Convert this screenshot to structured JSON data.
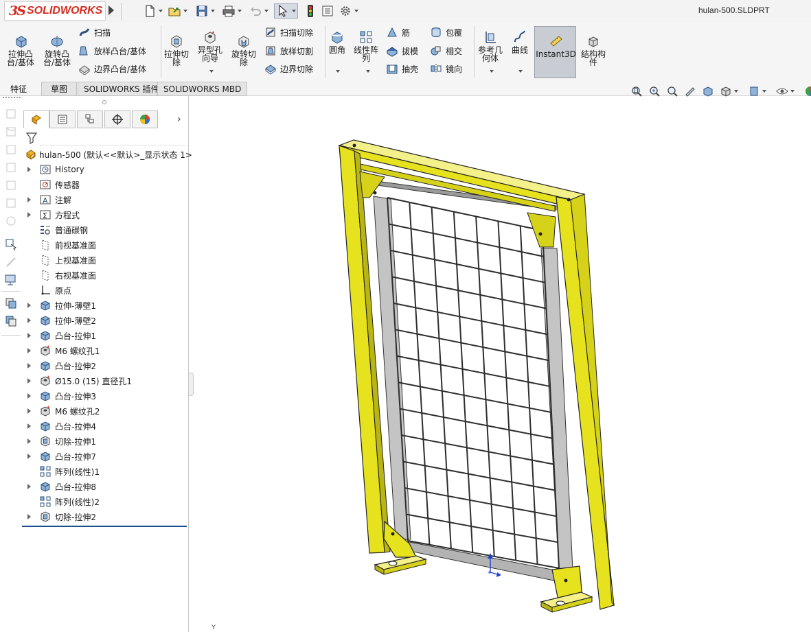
{
  "app": {
    "logo_ds": "3S",
    "logo_text": "SOLIDWORKS",
    "document_title": "hulan-500.SLDPRT"
  },
  "colors": {
    "brand_red": "#d52b1e",
    "frame_yellow": "#e6e21e",
    "panel_grey": "#bdbdbd",
    "active_tool_bg": "#c9cdd3"
  },
  "quick_access": [
    {
      "icon": "new-document-icon"
    },
    {
      "icon": "open-folder-icon"
    },
    {
      "icon": "save-icon"
    },
    {
      "icon": "print-icon"
    },
    {
      "icon": "undo-icon"
    },
    {
      "icon": "select-arrow-icon"
    },
    {
      "icon": "rebuild-traffic-light-icon"
    },
    {
      "icon": "file-properties-icon"
    },
    {
      "icon": "options-gear-icon"
    }
  ],
  "ribbon": {
    "extrude_boss_l1": "拉伸凸",
    "extrude_boss_l2": "台/基体",
    "revolve_boss_l1": "旋转凸",
    "revolve_boss_l2": "台/基体",
    "sweep": "扫描",
    "loft_boss": "放样凸台/基体",
    "boundary_boss": "边界凸台/基体",
    "extrude_cut_l1": "拉伸切",
    "extrude_cut_l2": "除",
    "hole_wizard_l1": "异型孔",
    "hole_wizard_l2": "向导",
    "revolve_cut_l1": "旋转切",
    "revolve_cut_l2": "除",
    "swept_cut": "扫描切除",
    "lofted_cut": "放样切割",
    "boundary_cut": "边界切除",
    "fillet": "圆角",
    "linear_pattern_l1": "线性阵",
    "linear_pattern_l2": "列",
    "rib": "筋",
    "draft": "拔模",
    "shell": "抽壳",
    "wrap": "包覆",
    "intersect": "相交",
    "mirror": "镜向",
    "ref_geometry_l1": "参考几",
    "ref_geometry_l2": "何体",
    "curves": "曲线",
    "instant3d": "Instant3D",
    "structure_l1": "结构构",
    "structure_l2": "件"
  },
  "tabs": [
    {
      "label": "特征"
    },
    {
      "label": "草图"
    },
    {
      "label": "SOLIDWORKS 插件"
    },
    {
      "label": "SOLIDWORKS MBD"
    }
  ],
  "feature_tree": {
    "root": "hulan-500  (默认<<默认>_显示状态 1>",
    "items": [
      {
        "label": "History",
        "icon": "history-icon",
        "expandable": true
      },
      {
        "label": "传感器",
        "icon": "sensor-icon",
        "expandable": false
      },
      {
        "label": "注解",
        "icon": "annotation-icon",
        "expandable": true
      },
      {
        "label": "方程式",
        "icon": "equation-icon",
        "expandable": true
      },
      {
        "label": "普通碳钢",
        "icon": "material-icon",
        "expandable": false
      },
      {
        "label": "前视基准面",
        "icon": "plane-icon",
        "expandable": false
      },
      {
        "label": "上视基准面",
        "icon": "plane-icon",
        "expandable": false
      },
      {
        "label": "右视基准面",
        "icon": "plane-icon",
        "expandable": false
      },
      {
        "label": "原点",
        "icon": "origin-icon",
        "expandable": false
      },
      {
        "label": "拉伸-薄壁1",
        "icon": "extrude-icon",
        "expandable": true
      },
      {
        "label": "拉伸-薄壁2",
        "icon": "extrude-icon",
        "expandable": true
      },
      {
        "label": "凸台-拉伸1",
        "icon": "extrude-icon",
        "expandable": true
      },
      {
        "label": "M6 螺纹孔1",
        "icon": "hole-icon",
        "expandable": true
      },
      {
        "label": "凸台-拉伸2",
        "icon": "extrude-icon",
        "expandable": true
      },
      {
        "label": "Ø15.0 (15) 直径孔1",
        "icon": "hole-icon",
        "expandable": true
      },
      {
        "label": "凸台-拉伸3",
        "icon": "extrude-icon",
        "expandable": true
      },
      {
        "label": "M6 螺纹孔2",
        "icon": "hole-icon",
        "expandable": true
      },
      {
        "label": "凸台-拉伸4",
        "icon": "extrude-icon",
        "expandable": true
      },
      {
        "label": "切除-拉伸1",
        "icon": "cut-icon",
        "expandable": true
      },
      {
        "label": "凸台-拉伸7",
        "icon": "extrude-icon",
        "expandable": true
      },
      {
        "label": "阵列(线性)1",
        "icon": "pattern-icon",
        "expandable": false
      },
      {
        "label": "凸台-拉伸8",
        "icon": "extrude-icon",
        "expandable": true
      },
      {
        "label": "阵列(线性)2",
        "icon": "pattern-icon",
        "expandable": false
      },
      {
        "label": "切除-拉伸2",
        "icon": "cut-icon",
        "expandable": true
      }
    ]
  },
  "panel": {
    "more_glyph": "›"
  },
  "viewport": {
    "triad_y_label": "Y"
  }
}
